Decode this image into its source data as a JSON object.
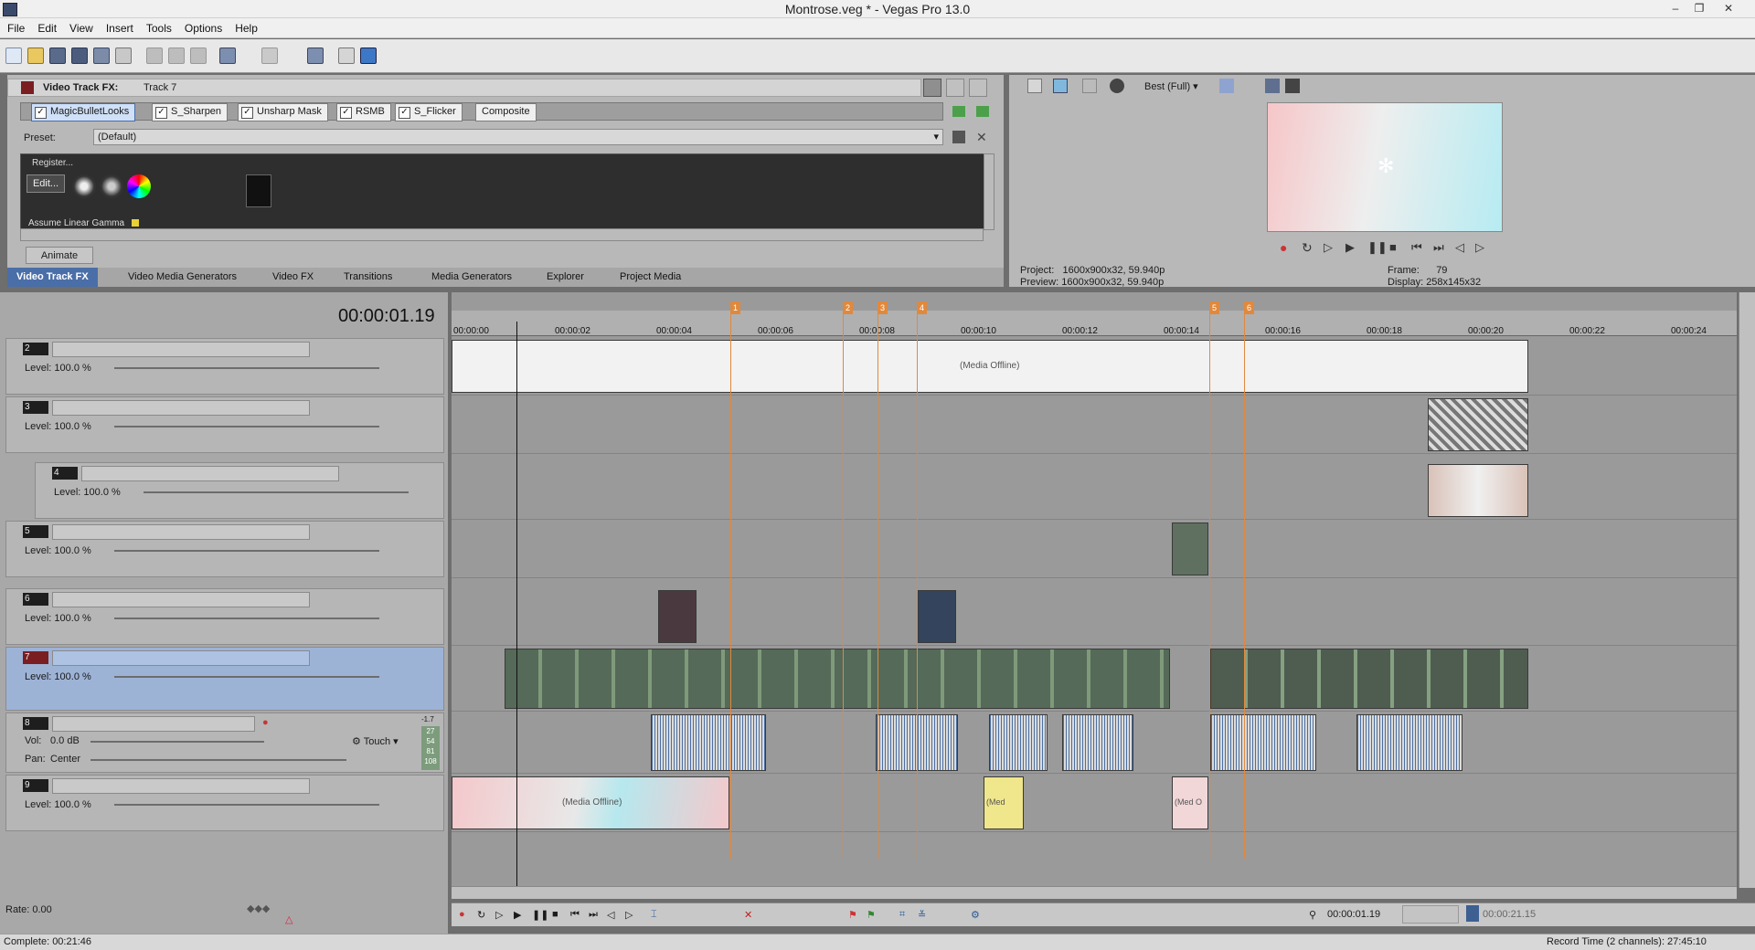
{
  "window": {
    "title": "Montrose.veg * - Vegas Pro 13.0",
    "minimize": "–",
    "restore": "❐",
    "close": "✕"
  },
  "menu": [
    "File",
    "Edit",
    "View",
    "Insert",
    "Tools",
    "Options",
    "Help"
  ],
  "fx_panel": {
    "header_title": "Video Track FX:",
    "header_track": "Track 7",
    "chain": [
      "MagicBulletLooks",
      "S_Sharpen",
      "Unsharp Mask",
      "RSMB",
      "S_Flicker",
      "Composite"
    ],
    "preset_label": "Preset:",
    "preset_value": "(Default)",
    "register_label": "Register...",
    "edit_label": "Edit...",
    "linear_gamma_label": "Assume Linear Gamma",
    "animate_label": "Animate"
  },
  "tabs": [
    "Video Track FX",
    "Video Media Generators",
    "Video FX",
    "Transitions",
    "Media Generators",
    "Explorer",
    "Project Media"
  ],
  "preview": {
    "quality": "Best (Full)",
    "project_label": "Project:",
    "project_value": "1600x900x32, 59.940p",
    "preview_label": "Preview:",
    "preview_value": "1600x900x32, 59.940p",
    "frame_label": "Frame:",
    "frame_value": "79",
    "display_label": "Display:",
    "display_value": "258x145x32"
  },
  "timeline": {
    "timecode": "00:00:01.19",
    "ruler": [
      "00:00:00",
      "00:00:02",
      "00:00:04",
      "00:00:06",
      "00:00:08",
      "00:00:10",
      "00:00:12",
      "00:00:14",
      "00:00:16",
      "00:00:18",
      "00:00:20",
      "00:00:22",
      "00:00:24"
    ],
    "markers": [
      "1",
      "2",
      "3",
      "4",
      "5",
      "6"
    ]
  },
  "tracks": [
    {
      "num": "2",
      "level_label": "Level: 100.0 %"
    },
    {
      "num": "3",
      "level_label": "Level: 100.0 %"
    },
    {
      "num": "4",
      "level_label": "Level: 100.0 %"
    },
    {
      "num": "5",
      "level_label": "Level: 100.0 %"
    },
    {
      "num": "6",
      "level_label": "Level: 100.0 %"
    },
    {
      "num": "7",
      "level_label": "Level: 100.0 %"
    },
    {
      "num": "8",
      "vol_label": "Vol:",
      "vol_value": "0.0 dB",
      "pan_label": "Pan:",
      "pan_value": "Center",
      "mode": "Touch",
      "meter": [
        "-1.7",
        "27",
        "54",
        "81",
        "108"
      ]
    },
    {
      "num": "9",
      "level_label": "Level: 100.0 %"
    }
  ],
  "clips": {
    "offline": "(Media Offline)",
    "offline_short1": "(Med",
    "offline_short2": "(Med O"
  },
  "bottom": {
    "rate": "Rate: 0.00",
    "complete": "Complete: 00:21:46",
    "cursor_time": "00:00:01.19",
    "end_time": "00:00:21.15",
    "record_time": "Record Time (2 channels): 27:45:10"
  },
  "colors": {
    "marker": "#e0893d",
    "selected_track": "#9db3d6",
    "accent": "#4a6ea8"
  }
}
